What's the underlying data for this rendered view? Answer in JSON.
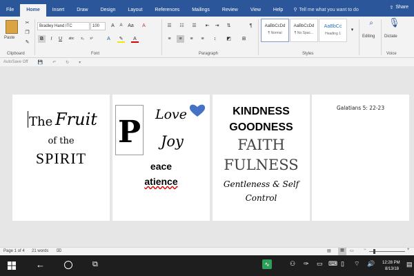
{
  "ribbon": {
    "tabs": [
      "File",
      "Home",
      "Insert",
      "Draw",
      "Design",
      "Layout",
      "References",
      "Mailings",
      "Review",
      "View",
      "Help"
    ],
    "active_tab": "Home",
    "tell_me": "Tell me what you want to do",
    "share": "Share",
    "font_name": "Bradley Hand ITC",
    "font_size": "100",
    "groups": {
      "clipboard": "Clipboard",
      "font": "Font",
      "paragraph": "Paragraph",
      "styles": "Styles",
      "voice": "Voice"
    },
    "paste": "Paste",
    "styles": [
      {
        "sample": "AaBbCcDd",
        "name": "¶ Normal"
      },
      {
        "sample": "AaBbCcDd",
        "name": "¶ No Spac..."
      },
      {
        "sample": "AaBbCc",
        "name": "Heading 1"
      }
    ],
    "editing": "Editing",
    "dictate": "Dictate"
  },
  "qat": {
    "autosave": "AutoSave",
    "autosave_state": "Off"
  },
  "pages": {
    "p1": {
      "line1a": "The",
      "line1b": "Fruit",
      "line2": "of the",
      "line3": "SPIRIT"
    },
    "p2": {
      "big_letter": "P",
      "love": "Love",
      "joy": "Joy",
      "peace": "eace",
      "patience": "atience"
    },
    "p3": {
      "kindness": "KINDNESS",
      "goodness": "GOODNESS",
      "faith": "FAITH",
      "fulness": "FULNESS",
      "gentleness": "Gentleness & Self",
      "control": "Control"
    },
    "p4": {
      "verse": "Galatians 5: 22-23"
    }
  },
  "status": {
    "page": "Page 1 of 4",
    "words": "21 words",
    "zoom_minus": "−",
    "zoom_plus": "+"
  },
  "taskbar": {
    "time": "12:28 PM",
    "date": "8/13/18"
  },
  "colors": {
    "brand": "#2b579a",
    "heart": "#4472c4"
  }
}
